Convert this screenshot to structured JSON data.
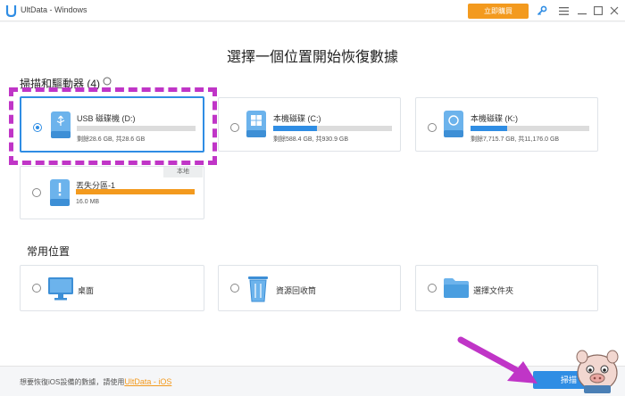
{
  "window": {
    "title": "UltData - Windows",
    "buy_label": "立即購買"
  },
  "heading": "選擇一個位置開始恢復數據",
  "drives_section": {
    "label": "掃描和驅動器 (4)"
  },
  "drives": [
    {
      "name": "USB 磁碟機 (D:)",
      "info": "剩餘28.6 GB, 共28.6 GB",
      "fill_fraction": 0.0,
      "bar_color": "#2f8de4",
      "selected": true
    },
    {
      "name": "本機磁碟 (C:)",
      "info": "剩餘588.4 GB, 共930.9 GB",
      "fill_fraction": 0.37,
      "bar_color": "#2f8de4",
      "selected": false
    },
    {
      "name": "本機磁碟 (K:)",
      "info": "剩餘7,715.7 GB, 共11,176.0 GB",
      "fill_fraction": 0.31,
      "bar_color": "#2f8de4",
      "selected": false
    },
    {
      "name": "丟失分區-1",
      "info": "16.0 MB",
      "fill_fraction": 1.0,
      "bar_color": "#f39a1e",
      "selected": false,
      "tag": "本地"
    }
  ],
  "common_section": {
    "label": "常用位置"
  },
  "locations": [
    {
      "label": "桌面",
      "icon": "monitor-icon"
    },
    {
      "label": "資源回收筒",
      "icon": "recycle-bin-icon"
    },
    {
      "label": "選擇文件夾",
      "icon": "folder-icon"
    }
  ],
  "footer": {
    "text": "想要恢復iOS設備的數據，請使用",
    "link": "UltData - iOS"
  },
  "scan_button": {
    "label": "掃描"
  },
  "colors": {
    "accent": "#2f8de4",
    "orange": "#f39a1e",
    "highlight": "#c035c7"
  }
}
